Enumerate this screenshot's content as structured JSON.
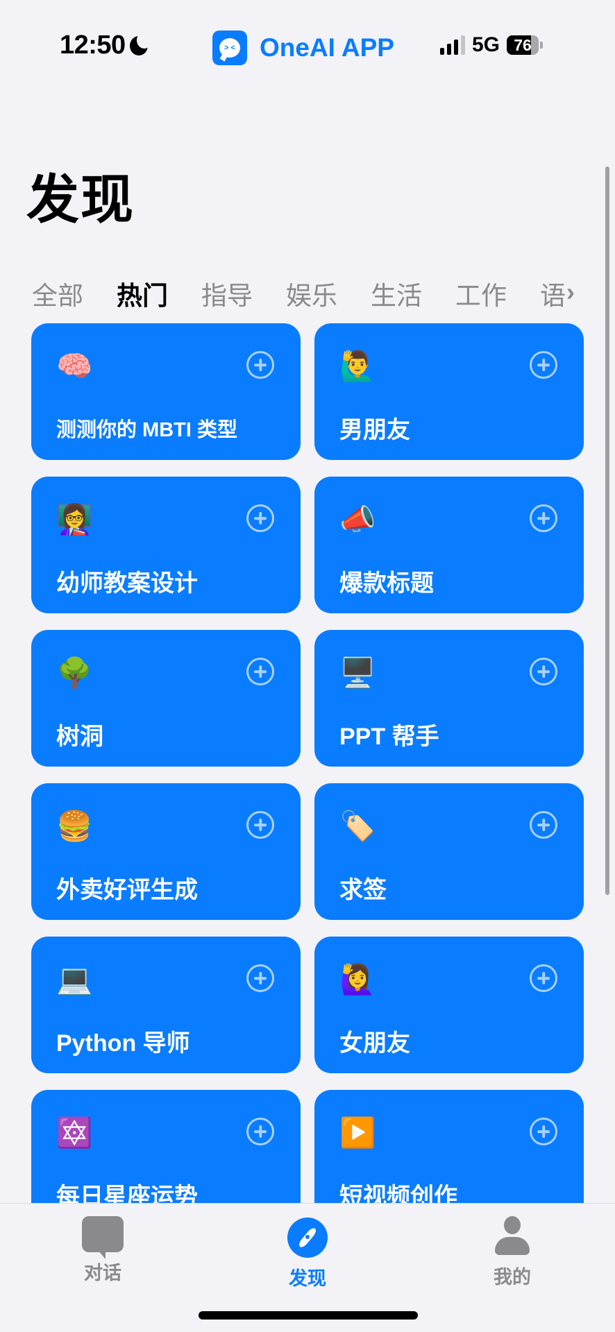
{
  "status_bar": {
    "time": "12:50",
    "focus_icon": "moon-icon",
    "network": "5G",
    "battery_level": "76",
    "signal_bars_active": 3,
    "signal_bars_total": 4
  },
  "app": {
    "name": "OneAI APP",
    "logo_face": "> <",
    "accent_color": "#0a7cff"
  },
  "page": {
    "title": "发现"
  },
  "categories": {
    "items": [
      {
        "label": "全部",
        "active": false
      },
      {
        "label": "热门",
        "active": true
      },
      {
        "label": "指导",
        "active": false
      },
      {
        "label": "娱乐",
        "active": false
      },
      {
        "label": "生活",
        "active": false
      },
      {
        "label": "工作",
        "active": false
      },
      {
        "label": "语",
        "active": false
      }
    ],
    "more_icon": "›"
  },
  "cards": [
    {
      "emoji": "🧠",
      "title": "测测你的 MBTI 类型"
    },
    {
      "emoji": "🙋‍♂️",
      "title": "男朋友"
    },
    {
      "emoji": "👩‍🏫",
      "title": "幼师教案设计"
    },
    {
      "emoji": "📣",
      "title": "爆款标题"
    },
    {
      "emoji": "🌳",
      "title": "树洞"
    },
    {
      "emoji": "🖥️",
      "title": "PPT 帮手"
    },
    {
      "emoji": "🍔",
      "title": "外卖好评生成"
    },
    {
      "emoji": "🏷️",
      "title": "求签"
    },
    {
      "emoji": "💻",
      "title": "Python 导师"
    },
    {
      "emoji": "🙋‍♀️",
      "title": "女朋友"
    },
    {
      "emoji": "🔯",
      "title": "每日星座运势"
    },
    {
      "emoji": "▶️",
      "title": "短视频创作"
    }
  ],
  "tab_bar": {
    "items": [
      {
        "label": "对话",
        "icon": "chat-bubble-icon",
        "active": false
      },
      {
        "label": "发现",
        "icon": "compass-icon",
        "active": true
      },
      {
        "label": "我的",
        "icon": "person-icon",
        "active": false
      }
    ]
  }
}
